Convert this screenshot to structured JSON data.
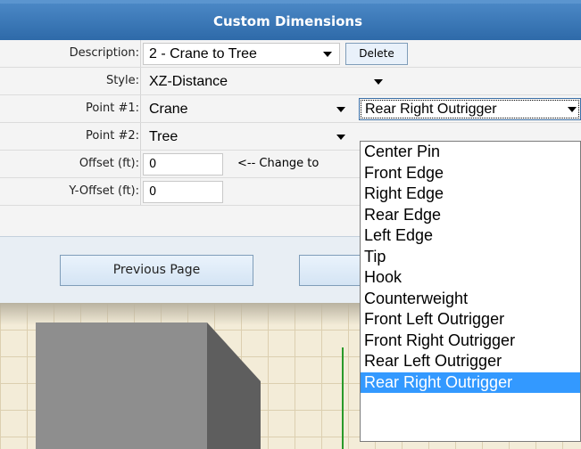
{
  "title": "Custom Dimensions",
  "form": {
    "description": {
      "label": "Description:",
      "value": "2 - Crane to Tree",
      "delete_label": "Delete"
    },
    "style": {
      "label": "Style:",
      "value": "XZ-Distance"
    },
    "point1": {
      "label": "Point #1:",
      "value": "Crane",
      "sub_value": "Rear Right Outrigger"
    },
    "point2": {
      "label": "Point #2:",
      "value": "Tree"
    },
    "offset": {
      "label": "Offset (ft):",
      "value": "0",
      "hint": "<-- Change to"
    },
    "yoffset": {
      "label": "Y-Offset (ft):",
      "value": "0"
    }
  },
  "buttons": {
    "previous_page": "Previous Page"
  },
  "dropdown": {
    "options": [
      "Center Pin",
      "Front Edge",
      "Right Edge",
      "Rear Edge",
      "Left Edge",
      "Tip",
      "Hook",
      "Counterweight",
      "Front Left Outrigger",
      "Front Right Outrigger",
      "Rear Left Outrigger",
      "Rear Right Outrigger"
    ],
    "selected_index": 11
  },
  "colors": {
    "header": "#3a78b8",
    "selection": "#3399ff",
    "green_line": "#2a9a2a"
  }
}
